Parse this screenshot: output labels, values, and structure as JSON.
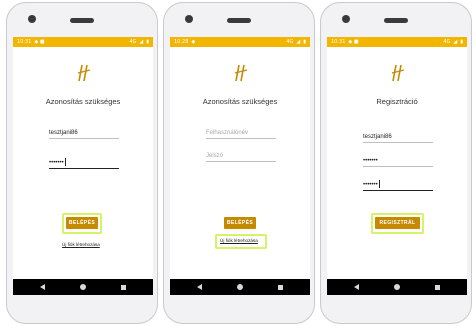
{
  "colors": {
    "accent": "#f2b600",
    "button": "#c58a00",
    "highlight": "#d8f06a"
  },
  "screens": [
    {
      "status_time": "10:31",
      "status_icons": "4G",
      "title": "Azonosítás szükséges",
      "username_value": "tesztjani86",
      "password_value": "•••••••",
      "login_label": "BELÉPÉS",
      "register_link": "Új fiók létrehozása"
    },
    {
      "status_time": "10:28",
      "status_icons": "4G",
      "title": "Azonosítás szükséges",
      "username_placeholder": "Felhasználónév",
      "password_placeholder": "Jelszó",
      "login_label": "BELÉPÉS",
      "register_link": "Új fiók létrehozása"
    },
    {
      "status_time": "10:31",
      "status_icons": "4G",
      "title": "Regisztráció",
      "username_value": "tesztjani86",
      "password_value": "•••••••",
      "password_confirm_value": "•••••••",
      "register_label": "REGISZTRÁL"
    }
  ]
}
